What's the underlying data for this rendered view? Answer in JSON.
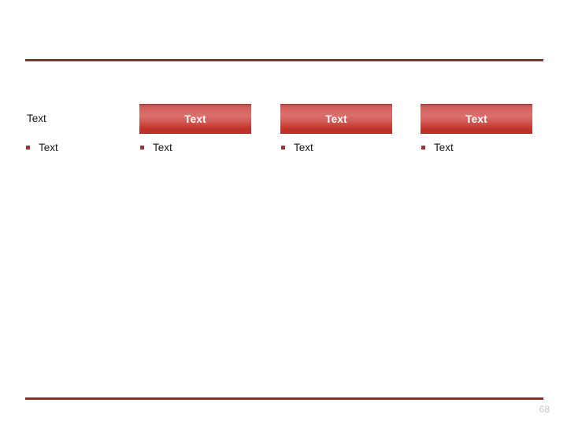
{
  "slide": {
    "page_number": "68",
    "accent_color": "#8c2f2f",
    "button_color": "#c0504d",
    "bullet_color": "#953735",
    "page_number_color": "#c9c9c9",
    "background_color": "#ffffff"
  },
  "rules": {
    "top_label": "top-divider",
    "bottom_label": "bottom-divider"
  },
  "columns": [
    {
      "style": "plain",
      "header": "Text",
      "bullet": "Text"
    },
    {
      "style": "button",
      "header": "Text",
      "bullet": "Text"
    },
    {
      "style": "button",
      "header": "Text",
      "bullet": "Text"
    },
    {
      "style": "button",
      "header": "Text",
      "bullet": "Text"
    }
  ]
}
